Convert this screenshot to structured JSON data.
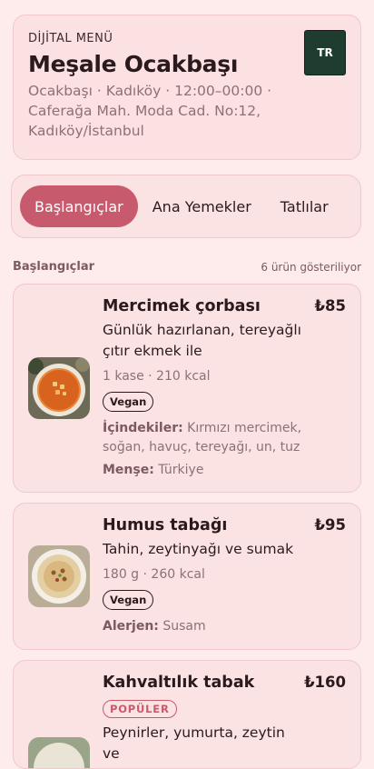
{
  "header": {
    "kicker": "DİJİTAL MENÜ",
    "title": "Meşale Ocakbaşı",
    "subtitle": "Ocakbaşı · Kadıköy · 12:00–00:00 · Caferağa Mah. Moda Cad. No:12, Kadıköy/İstanbul",
    "language_label": "TR"
  },
  "tabs": [
    {
      "label": "Başlangıçlar",
      "active": true
    },
    {
      "label": "Ana Yemekler",
      "active": false
    },
    {
      "label": "Tatlılar",
      "active": false
    }
  ],
  "section": {
    "title": "Başlangıçlar",
    "count_text": "6 ürün gösteriliyor"
  },
  "items": [
    {
      "name": "Mercimek çorbası",
      "price": "₺85",
      "description": "Günlük hazırlanan, tereyağlı çıtır ekmek ile",
      "meta": "1 kase · 210 kcal",
      "badge": "Vegan",
      "ingredients_label": "İçindekiler:",
      "ingredients": "Kırmızı mercimek, soğan, havuç, tereyağı, un, tuz",
      "origin_label": "Menşe:",
      "origin": "Türkiye"
    },
    {
      "name": "Humus tabağı",
      "price": "₺95",
      "description": "Tahin, zeytinyağı ve sumak",
      "meta": "180 g · 260 kcal",
      "badge": "Vegan",
      "allergen_label": "Alerjen:",
      "allergen": "Susam"
    },
    {
      "name": "Kahvaltılık tabak",
      "price": "₺160",
      "popular": "POPÜLER",
      "description": "Peynirler, yumurta, zeytin ve"
    }
  ],
  "colors": {
    "accent": "#c85a6e",
    "background": "#fdeceb",
    "card": "#fbe2e3",
    "language_button": "#1e3d30"
  }
}
